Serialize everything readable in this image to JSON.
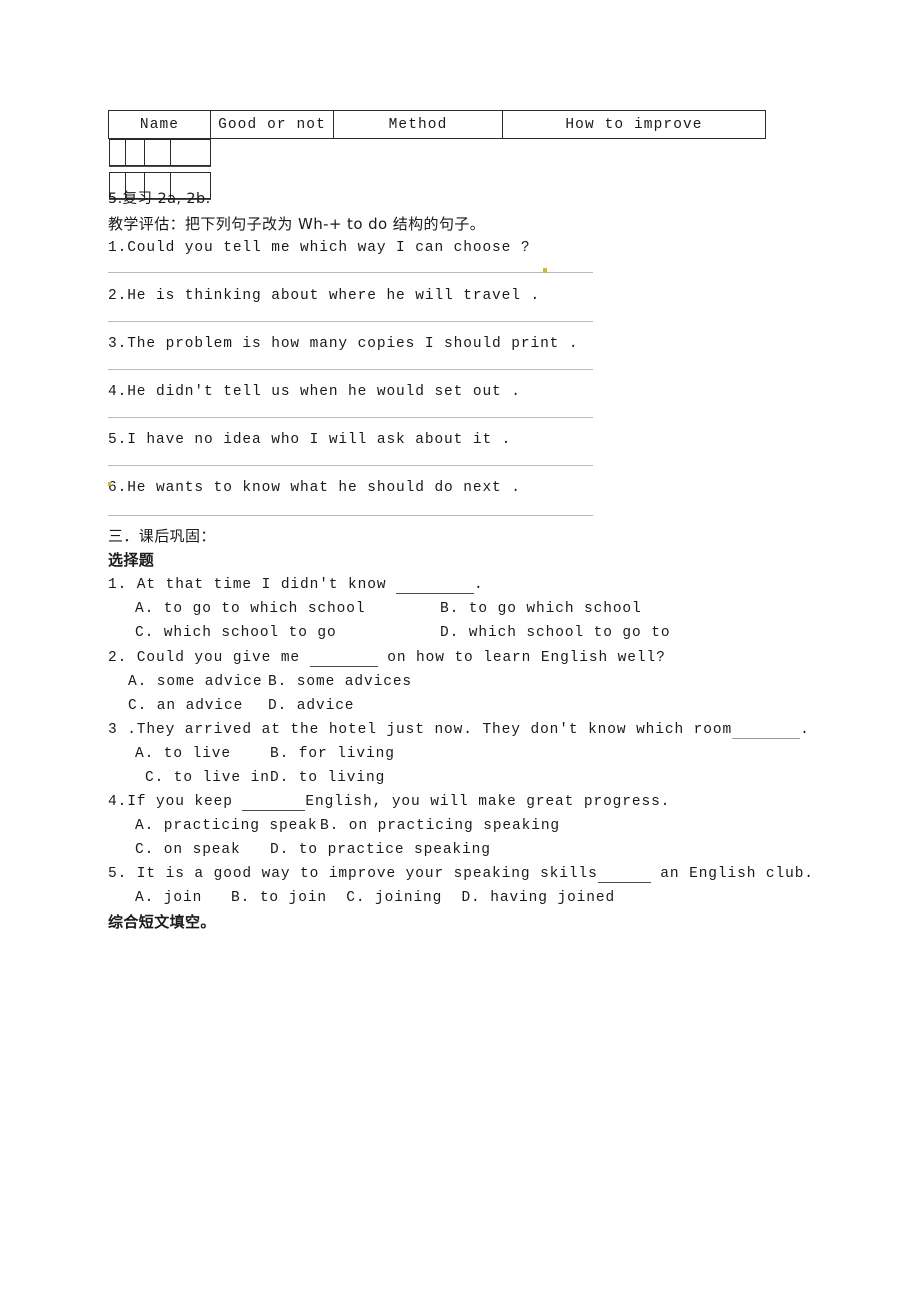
{
  "table": {
    "headers": [
      "Name",
      "Good or not",
      "Method",
      "How to improve"
    ],
    "empty_rows": 2
  },
  "review": {
    "item5": "5.复习 2a, 2b.",
    "instruction": "教学评估：把下列句子改为 Wh-+ to do 结构的句子。"
  },
  "rewrite_sentences": [
    "1.Could you tell me which way I can choose ?",
    "2.He is thinking about where he will travel .",
    "3.The problem is how many copies I should print .",
    "4.He didn't tell us when he would set out .",
    "5.I have no idea who I will ask about it .",
    "6.He wants to know what he should do next ."
  ],
  "section": {
    "heading": "三．课后巩固：",
    "subheading": "选择题",
    "closing_heading": "综合短文填空。"
  },
  "questions": [
    {
      "stem_before": "1. At that time I didn't know ",
      "stem_after": ".",
      "options_left": [
        "A. to go to which school",
        "C. which school to go"
      ],
      "options_right": [
        "B. to go which school",
        "D. which school to go to"
      ]
    },
    {
      "stem_before": "2. Could you give me ",
      "stem_after": " on how to learn English well?",
      "options_left": [
        "A. some advice",
        "C. an advice"
      ],
      "options_right": [
        "B. some advices",
        "D. advice"
      ]
    },
    {
      "stem_before": "3 .They arrived at the hotel just now. They don't know which room",
      "stem_after": ".",
      "options_left": [
        "A. to live",
        "C. to live in"
      ],
      "options_right": [
        "B. for living",
        "D. to living"
      ]
    },
    {
      "stem_before": "4.If you keep ",
      "stem_after": "English, you will make great progress.",
      "options_left": [
        "A. practicing speak",
        "C. on speak"
      ],
      "options_right": [
        "B. on practicing speaking",
        "D. to practice speaking"
      ]
    },
    {
      "stem_before": "5. It is a good way to improve your speaking skills",
      "stem_after": " an English club.",
      "options_inline": "A. join   B. to join  C. joining  D. having joined"
    }
  ],
  "colors": {
    "text": "#1a1a1a",
    "rule": "#b9b9b9",
    "border": "#2b2b2b",
    "tick": "#c9bb3a"
  }
}
